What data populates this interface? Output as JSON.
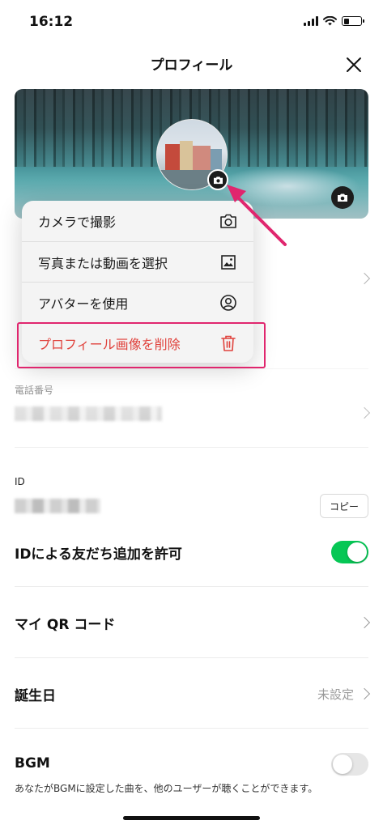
{
  "status_bar": {
    "time": "16:12",
    "icons": [
      "signal-icon",
      "wifi-icon",
      "battery-icon"
    ],
    "battery_level": 0.3
  },
  "header": {
    "title": "プロフィール",
    "close_icon": "close-icon"
  },
  "photo_menu": {
    "items": [
      {
        "label": "カメラで撮影",
        "icon": "camera-icon"
      },
      {
        "label": "写真または動画を選択",
        "icon": "image-icon"
      },
      {
        "label": "アバターを使用",
        "icon": "avatar-icon"
      },
      {
        "label": "プロフィール画像を削除",
        "icon": "trash-icon",
        "danger": true
      }
    ]
  },
  "profile": {
    "phone_label": "電話番号",
    "id_label": "ID",
    "copy_label": "コピー"
  },
  "settings": {
    "allow_id_add_label": "IDによる友だち追加を許可",
    "allow_id_add_enabled": true,
    "qr_label": "マイ QR コード",
    "birthday_label": "誕生日",
    "birthday_value": "未設定",
    "bgm_label": "BGM",
    "bgm_enabled": false,
    "bgm_description": "あなたがBGMに設定した曲を、他のユーザーが聴くことができます。"
  },
  "colors": {
    "danger": "#e0423c",
    "toggle_on": "#06c755",
    "annotation": "#e0266e"
  }
}
